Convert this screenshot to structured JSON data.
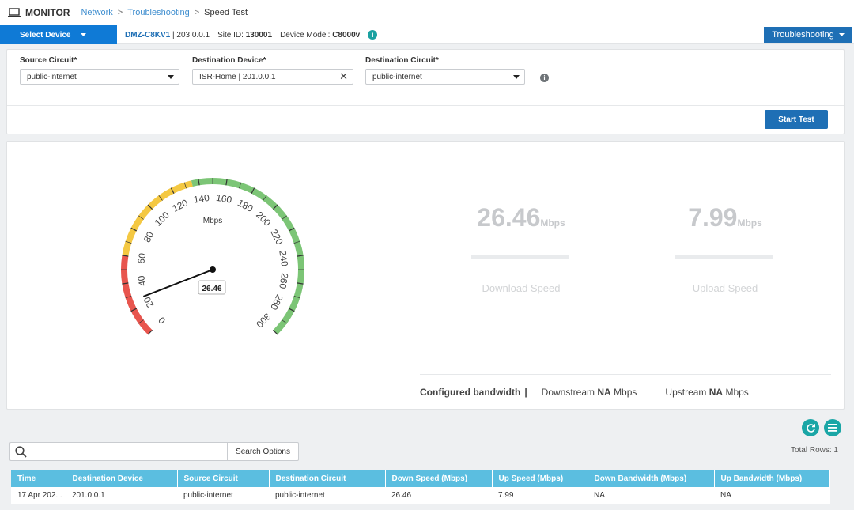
{
  "header": {
    "app_title": "MONITOR",
    "breadcrumb": [
      "Network",
      "Troubleshooting",
      "Speed Test"
    ]
  },
  "device_bar": {
    "select_label": "Select Device",
    "hostname": "DMZ-C8KV1",
    "ip": "| 203.0.0.1",
    "site_label": "Site ID:",
    "site_id": "130001",
    "model_label": "Device Model:",
    "model": "C8000v",
    "troubleshooting_btn": "Troubleshooting"
  },
  "form": {
    "source_label": "Source Circuit*",
    "source_value": "public-internet",
    "dest_device_label": "Destination Device*",
    "dest_device_value": "ISR-Home | 201.0.0.1",
    "dest_circuit_label": "Destination Circuit*",
    "dest_circuit_value": "public-internet",
    "start_button": "Start Test"
  },
  "gauge": {
    "unit": "Mbps",
    "value": 26.46,
    "value_label": "26.46",
    "min": 0,
    "max": 300,
    "ticks": [
      "0",
      "20",
      "40",
      "60",
      "80",
      "100",
      "120",
      "140",
      "160",
      "180",
      "200",
      "220",
      "240",
      "260",
      "280",
      "300"
    ],
    "colors": {
      "red": "#e8554e",
      "yellow": "#f4c842",
      "green": "#7cc576"
    }
  },
  "results": {
    "download_value": "26.46",
    "download_unit": "Mbps",
    "download_label": "Download Speed",
    "upload_value": "7.99",
    "upload_unit": "Mbps",
    "upload_label": "Upload Speed",
    "configured_label": "Configured bandwidth",
    "downstream_label": "Downstream",
    "downstream_value": "NA",
    "downstream_unit": "Mbps",
    "upstream_label": "Upstream",
    "upstream_value": "NA",
    "upstream_unit": "Mbps"
  },
  "table": {
    "search_options": "Search Options",
    "total_rows": "Total Rows: 1",
    "columns": [
      "Time",
      "Destination Device",
      "Source Circuit",
      "Destination Circuit",
      "Down Speed (Mbps)",
      "Up Speed (Mbps)",
      "Down Bandwidth (Mbps)",
      "Up Bandwidth (Mbps)"
    ],
    "rows": [
      [
        "17 Apr 202...",
        "201.0.0.1",
        "public-internet",
        "public-internet",
        "26.46",
        "7.99",
        "NA",
        "NA"
      ]
    ]
  },
  "icons": [
    "laptop-icon",
    "chevron-down-icon",
    "info-icon",
    "close-icon",
    "refresh-icon",
    "menu-icon",
    "search-icon"
  ]
}
